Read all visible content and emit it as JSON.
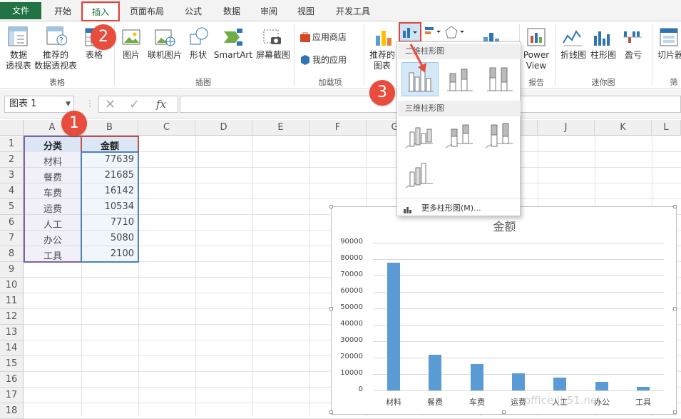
{
  "tabs": [
    {
      "label": "文件"
    },
    {
      "label": "开始"
    },
    {
      "label": "插入"
    },
    {
      "label": "页面布局"
    },
    {
      "label": "公式"
    },
    {
      "label": "数据"
    },
    {
      "label": "审阅"
    },
    {
      "label": "视图"
    },
    {
      "label": "开发工具"
    }
  ],
  "ribbon": {
    "pivot_label_1": "数据",
    "pivot_label_2": "透视表",
    "rec_pivot_label_1": "推荐的",
    "rec_pivot_label_2": "数据透视表",
    "table_label": "表格",
    "picture_label": "图片",
    "online_picture_label": "联机图片",
    "shapes_label": "形状",
    "smartart_label": "SmartArt",
    "screenshot_label": "屏幕截图",
    "store_label": "应用商店",
    "myapps_label": "我的应用",
    "rec_chart_label_1": "推荐的",
    "rec_chart_label_2": "图表",
    "powerview_label_1": "Power",
    "powerview_label_2": "View",
    "line_label": "折线图",
    "column_label": "柱形图",
    "winloss_label": "盈亏",
    "slicer_label": "切片器",
    "groups": {
      "tables": "表格",
      "illustrations": "插图",
      "addins": "加载项",
      "reports": "报告",
      "sparklines": "迷你图",
      "filter": "筛"
    }
  },
  "formula_bar": {
    "name_box": "图表 1",
    "fx": "fx"
  },
  "sheet": {
    "columns": [
      "A",
      "B",
      "C",
      "D",
      "E",
      "F",
      "G",
      "H",
      "I",
      "J",
      "K",
      "L"
    ],
    "rows": [
      "1",
      "2",
      "3",
      "4",
      "5",
      "6",
      "7",
      "8",
      "9",
      "10",
      "11",
      "12",
      "13",
      "14",
      "15",
      "16",
      "17",
      "18"
    ],
    "header_a": "分类",
    "header_b": "金额",
    "data": [
      {
        "cat": "材料",
        "amt": "77639"
      },
      {
        "cat": "餐费",
        "amt": "21685"
      },
      {
        "cat": "车费",
        "amt": "16142"
      },
      {
        "cat": "运费",
        "amt": "10534"
      },
      {
        "cat": "人工",
        "amt": "7710"
      },
      {
        "cat": "办公",
        "amt": "5080"
      },
      {
        "cat": "工具",
        "amt": "2100"
      }
    ]
  },
  "dropdown": {
    "section_2d": "二维柱形图",
    "section_3d": "三维柱形图",
    "more_label": "更多柱形图(M)..."
  },
  "steps": {
    "one": "1",
    "two": "2",
    "three": "3"
  },
  "watermark": "office.jb51.net",
  "colors": {
    "accent_green": "#217346",
    "highlight_red": "#e0463d",
    "bar_blue": "#5b9bd5"
  },
  "chart_data": {
    "type": "bar",
    "title": "金额",
    "categories": [
      "材料",
      "餐费",
      "车费",
      "运费",
      "人工",
      "办公",
      "工具"
    ],
    "values": [
      77639,
      21685,
      16142,
      10534,
      7710,
      5080,
      2100
    ],
    "ylim": [
      0,
      90000
    ],
    "yticks": [
      "90000",
      "80000",
      "70000",
      "60000",
      "50000",
      "40000",
      "30000",
      "20000",
      "10000",
      "0"
    ],
    "grid": true
  }
}
